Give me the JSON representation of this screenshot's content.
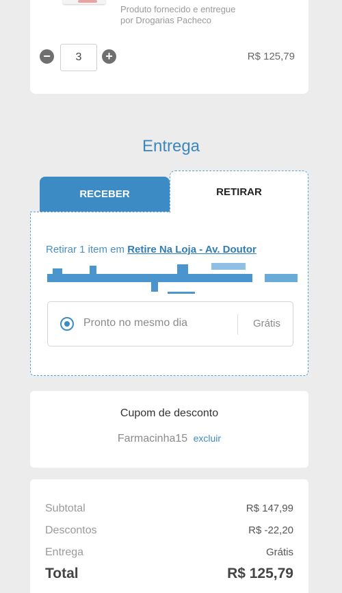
{
  "product": {
    "supplier_text": "Produto fornecido e entregue por Drogarias Pacheco",
    "quantity": "3",
    "minus_symbol": "−",
    "plus_symbol": "+",
    "price": "R$ 125,79"
  },
  "delivery": {
    "title": "Entrega",
    "tabs": {
      "receber": "RECEBER",
      "retirar": "RETIRAR"
    },
    "pickup_prefix": "Retirar 1 item em ",
    "store_link": "Retire Na Loja - Av. Doutor",
    "option": {
      "label": "Pronto no mesmo dia",
      "price": "Grátis"
    }
  },
  "coupon": {
    "title": "Cupom de desconto",
    "code": "Farmacinha15",
    "remove_label": "excluir"
  },
  "summary": {
    "subtotal_label": "Subtotal",
    "subtotal_value": "R$ 147,99",
    "discount_label": "Descontos",
    "discount_value": "R$ -22,20",
    "delivery_label": "Entrega",
    "delivery_value": "Grátis",
    "total_label": "Total",
    "total_value": "R$ 125,79"
  },
  "colors": {
    "accent": "#3d8bc5",
    "background": "#ececec"
  }
}
